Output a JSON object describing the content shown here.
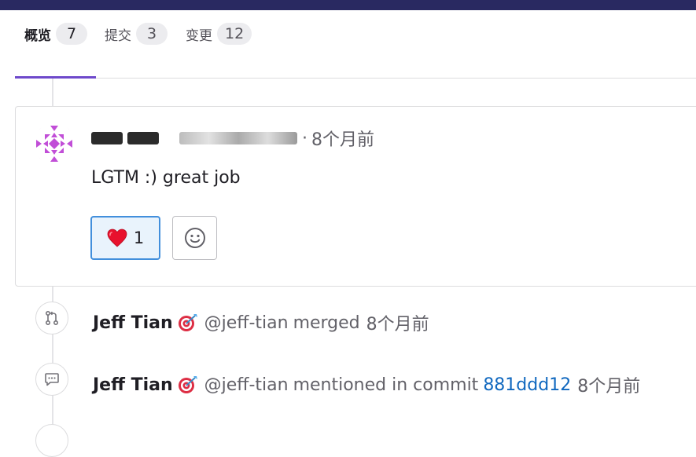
{
  "tabs": [
    {
      "label": "概览",
      "count": "7",
      "active": true
    },
    {
      "label": "提交",
      "count": "3",
      "active": false
    },
    {
      "label": "变更",
      "count": "12",
      "active": false
    }
  ],
  "note": {
    "author_separator": "·",
    "time": "8个月前",
    "body": "LGTM :) great job",
    "reactions": [
      {
        "emoji": "❤️",
        "count": "1"
      }
    ],
    "add_reaction_icon": "smile-icon"
  },
  "events": [
    {
      "icon": "merge-request-icon",
      "author": "Jeff Tian",
      "badge": "🎯",
      "username": "@jeff-tian",
      "action": "merged",
      "time": "8个月前"
    },
    {
      "icon": "comment-icon",
      "author": "Jeff Tian",
      "badge": "🎯",
      "username": "@jeff-tian",
      "action": "mentioned in commit",
      "commit": "881ddd12",
      "time": "8个月前"
    }
  ],
  "colors": {
    "topbar": "#292961",
    "tab_active_underline": "#6e49cb",
    "link": "#1068bf",
    "reaction_active_bg": "#e9f3fc",
    "reaction_active_border": "#428fdc",
    "avatar": "#c14ed7"
  }
}
